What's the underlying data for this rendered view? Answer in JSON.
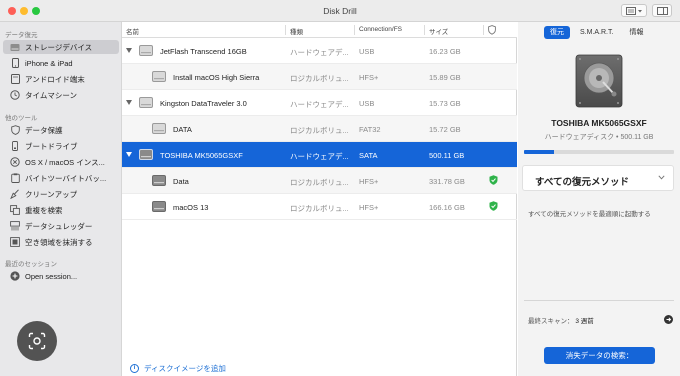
{
  "window": {
    "title": "Disk Drill"
  },
  "sidebar": {
    "sections": [
      {
        "label": "データ復元"
      },
      {
        "label": "他のツール"
      },
      {
        "label": "最近のセッション"
      }
    ],
    "items": [
      {
        "label": "ストレージデバイス",
        "icon": "hard-drive-icon"
      },
      {
        "label": "iPhone & iPad",
        "icon": "phone-icon"
      },
      {
        "label": "アンドロイド端末",
        "icon": "android-icon"
      },
      {
        "label": "タイムマシーン",
        "icon": "clock-icon"
      },
      {
        "label": "データ保護",
        "icon": "shield-icon"
      },
      {
        "label": "ブートドライブ",
        "icon": "usb-drive-icon"
      },
      {
        "label": "OS X / macOS インス...",
        "icon": "x-circle-icon"
      },
      {
        "label": "バイトツーバイトバッ...",
        "icon": "clipboard-icon"
      },
      {
        "label": "クリーンアップ",
        "icon": "broom-icon"
      },
      {
        "label": "重複を検索",
        "icon": "duplicate-icon"
      },
      {
        "label": "データシュレッダー",
        "icon": "shredder-icon"
      },
      {
        "label": "空き領域を抹消する",
        "icon": "erase-icon"
      },
      {
        "label": "Open session...",
        "icon": "plus-icon"
      }
    ]
  },
  "table": {
    "columns": [
      "名前",
      "種類",
      "Connection/FS",
      "サイズ"
    ],
    "rows": [
      {
        "name": "JetFlash Transcend 16GB",
        "type": "ハードウェアデ...",
        "fs": "USB",
        "size": "16.23 GB",
        "level": 0,
        "expandable": true
      },
      {
        "name": "Install macOS High Sierra",
        "type": "ロジカルボリュ...",
        "fs": "HFS+",
        "size": "15.89 GB",
        "level": 1
      },
      {
        "name": "Kingston DataTraveler 3.0",
        "type": "ハードウェアデ...",
        "fs": "USB",
        "size": "15.73 GB",
        "level": 0,
        "expandable": true
      },
      {
        "name": "DATA",
        "type": "ロジカルボリュ...",
        "fs": "FAT32",
        "size": "15.72 GB",
        "level": 1
      },
      {
        "name": "TOSHIBA MK5065GSXF",
        "type": "ハードウェアデ...",
        "fs": "SATA",
        "size": "500.11 GB",
        "level": 0,
        "expandable": true,
        "selected": true
      },
      {
        "name": "Data",
        "type": "ロジカルボリュ...",
        "fs": "HFS+",
        "size": "331.78 GB",
        "level": 1,
        "protected": true
      },
      {
        "name": "macOS 13",
        "type": "ロジカルボリュ...",
        "fs": "HFS+",
        "size": "166.16 GB",
        "level": 1,
        "protected": true
      }
    ],
    "add_image_label": "ディスクイメージを追加"
  },
  "right_panel": {
    "tabs": [
      "復元",
      "S.M.A.R.T.",
      "情報"
    ],
    "active_tab": "復元",
    "disk_name": "TOSHIBA MK5065GSXF",
    "disk_subtitle": "ハードウェアディスク • 500.11 GB",
    "usage_fraction": 0.2,
    "method_label": "すべての復元メソッド",
    "method_description": "すべての復元メソッドを最適順に起動する",
    "last_scan_label": "最終スキャン：",
    "last_scan_value": "3 週前",
    "scan_button_label": "消失データの検索："
  },
  "colors": {
    "accent": "#1565d8",
    "protected": "#2fb34a",
    "sidebar_bg": "#e8e8ea"
  }
}
